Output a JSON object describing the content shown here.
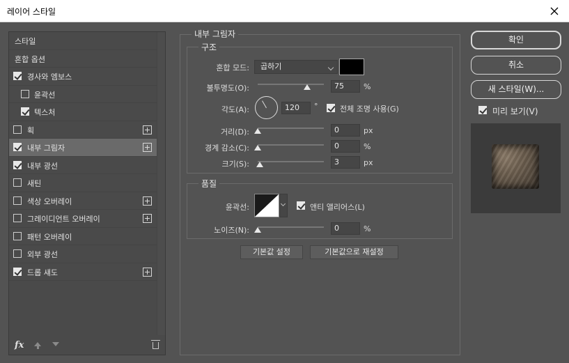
{
  "window": {
    "title": "레이어 스타일"
  },
  "sidebar": {
    "items": [
      {
        "label": "스타일",
        "checkbox": null,
        "plus": false,
        "selected": false
      },
      {
        "label": "혼합 옵션",
        "checkbox": null,
        "plus": false,
        "selected": false
      },
      {
        "label": "경사와 엠보스",
        "checkbox": true,
        "plus": false,
        "selected": false
      },
      {
        "label": "윤곽선",
        "checkbox": false,
        "plus": false,
        "selected": false,
        "sub": true
      },
      {
        "label": "텍스처",
        "checkbox": true,
        "plus": false,
        "selected": false,
        "sub": true
      },
      {
        "label": "획",
        "checkbox": false,
        "plus": true,
        "selected": false
      },
      {
        "label": "내부 그림자",
        "checkbox": true,
        "plus": true,
        "selected": true
      },
      {
        "label": "내부 광선",
        "checkbox": true,
        "plus": false,
        "selected": false
      },
      {
        "label": "새틴",
        "checkbox": false,
        "plus": false,
        "selected": false
      },
      {
        "label": "색상 오버레이",
        "checkbox": false,
        "plus": true,
        "selected": false
      },
      {
        "label": "그레이디언트 오버레이",
        "checkbox": false,
        "plus": true,
        "selected": false
      },
      {
        "label": "패턴 오버레이",
        "checkbox": false,
        "plus": false,
        "selected": false
      },
      {
        "label": "외부 광선",
        "checkbox": false,
        "plus": false,
        "selected": false
      },
      {
        "label": "드롭 섀도",
        "checkbox": true,
        "plus": true,
        "selected": false
      }
    ],
    "fx_label": "fx"
  },
  "panel": {
    "title": "내부 그림자",
    "structure": {
      "legend": "구조",
      "blend_mode": {
        "label": "혼합 모드:",
        "value": "곱하기",
        "color": "#000000"
      },
      "opacity": {
        "label": "불투명도(O):",
        "value": "75",
        "unit": "%",
        "level": 75
      },
      "angle": {
        "label": "각도(A):",
        "value": "120",
        "unit": "°",
        "global_light": {
          "label": "전체 조명 사용(G)",
          "checked": true
        }
      },
      "distance": {
        "label": "거리(D):",
        "value": "0",
        "unit": "px",
        "level": 0
      },
      "choke": {
        "label": "경계 감소(C):",
        "value": "0",
        "unit": "%",
        "level": 0
      },
      "size": {
        "label": "크기(S):",
        "value": "3",
        "unit": "px",
        "level": 3
      }
    },
    "quality": {
      "legend": "품질",
      "contour": {
        "label": "윤곽선:",
        "anti_alias": {
          "label": "앤티 앨리어스(L)",
          "checked": true
        }
      },
      "noise": {
        "label": "노이즈(N):",
        "value": "0",
        "unit": "%",
        "level": 0
      }
    },
    "buttons": {
      "make_default": "기본값 설정",
      "reset_default": "기본값으로 재설정"
    }
  },
  "actions": {
    "ok": "확인",
    "cancel": "취소",
    "new_style": "새 스타일(W)...",
    "preview": {
      "label": "미리 보기(V)",
      "checked": true
    }
  }
}
